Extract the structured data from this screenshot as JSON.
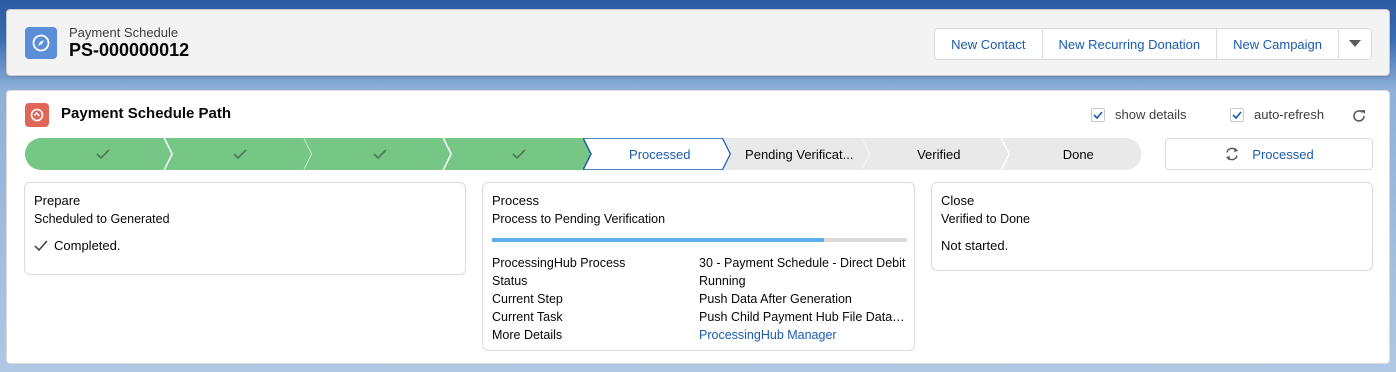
{
  "header": {
    "record_type": "Payment Schedule",
    "record_name": "PS-000000012",
    "icon": "compass-icon",
    "actions": [
      "New Contact",
      "New Recurring Donation",
      "New Campaign"
    ],
    "dropdown_icon": "chevron-down-icon"
  },
  "path": {
    "title": "Payment Schedule Path",
    "icon": "path-icon",
    "options": {
      "show_details": {
        "label": "show details",
        "checked": true
      },
      "auto_refresh": {
        "label": "auto-refresh",
        "checked": true
      }
    },
    "stages": [
      {
        "label": "",
        "state": "complete"
      },
      {
        "label": "",
        "state": "complete"
      },
      {
        "label": "",
        "state": "complete"
      },
      {
        "label": "",
        "state": "complete"
      },
      {
        "label": "Processed",
        "state": "current"
      },
      {
        "label": "Pending Verificat...",
        "state": "incomplete"
      },
      {
        "label": "Verified",
        "state": "incomplete"
      },
      {
        "label": "Done",
        "state": "incomplete"
      }
    ],
    "mark_button": "Processed",
    "colors": {
      "complete": "#76c785",
      "current_border": "#1a5bb0",
      "incomplete": "#e9e9e9",
      "accent": "#1a5bb0"
    }
  },
  "panels": {
    "prepare": {
      "title": "Prepare",
      "subtitle": "Scheduled to Generated",
      "status": "Completed."
    },
    "process": {
      "title": "Process",
      "subtitle": "Process to Pending Verification",
      "progress": 0.8,
      "details": [
        {
          "key": "ProcessingHub Process",
          "value": "30 - Payment Schedule - Direct Debit"
        },
        {
          "key": "Status",
          "value": "Running"
        },
        {
          "key": "Current Step",
          "value": "Push Data After Generation"
        },
        {
          "key": "Current Task",
          "value": "Push Child Payment Hub File Data T..."
        },
        {
          "key": "More Details",
          "value": "ProcessingHub Manager",
          "link": true
        }
      ]
    },
    "close": {
      "title": "Close",
      "subtitle": "Verified to Done",
      "status": "Not started."
    }
  }
}
